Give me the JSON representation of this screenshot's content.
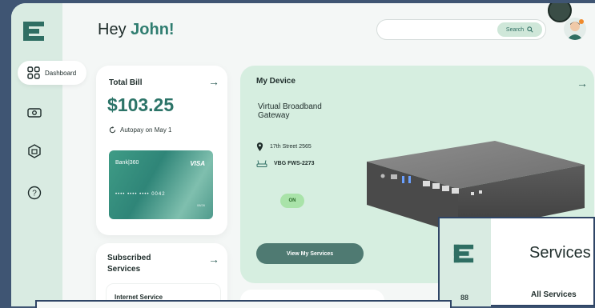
{
  "header": {
    "greeting": "Hey",
    "user_name": "John!",
    "search_label": "Search"
  },
  "sidebar": {
    "items": [
      {
        "label": "Dashboard",
        "icon": "dashboard-grid-icon",
        "active": true
      },
      {
        "label": "",
        "icon": "money-icon"
      },
      {
        "label": "",
        "icon": "package-icon"
      },
      {
        "label": "",
        "icon": "help-icon"
      }
    ]
  },
  "bill": {
    "title": "Total Bill",
    "amount": "$103.25",
    "autopay": "Autopay on May 1",
    "card": {
      "bank": "Bank|360",
      "brand": "VISA",
      "number": "•••• •••• •••• 0042",
      "expiry": "08/26"
    }
  },
  "subscribed": {
    "title": "Subscribed Services",
    "first_item": "Internet Service"
  },
  "device": {
    "title": "My Device",
    "name": "Virtual Broadband Gateway",
    "address": "17th Street 2565",
    "model": "VBG FWS-2273",
    "status": "ON",
    "view_button": "View My Services"
  },
  "overlay": {
    "title": "Services",
    "subtitle": "All Services"
  },
  "colors": {
    "accent": "#2f7d70",
    "sidebar": "#d9ebe2",
    "device_card": "#d6eee0",
    "button": "#4f7a72",
    "status_on": "#a9e3a9",
    "background": "#3f5573"
  }
}
